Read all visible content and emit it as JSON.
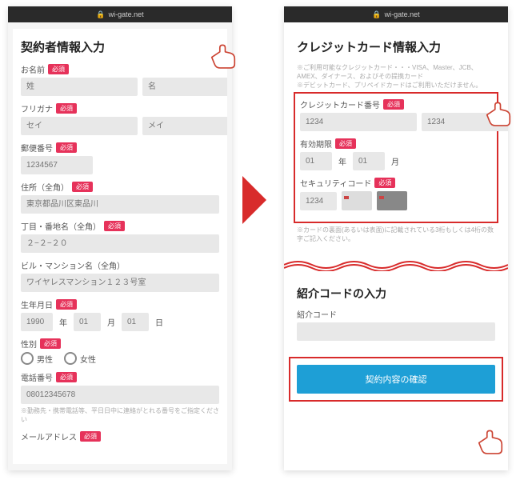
{
  "url": "wi-gate.net",
  "screen1": {
    "title": "契約者情報入力",
    "name": {
      "label": "お名前",
      "req": "必須",
      "sur": "姓",
      "giv": "名"
    },
    "kana": {
      "label": "フリガナ",
      "req": "必須",
      "sur": "セイ",
      "giv": "メイ"
    },
    "zip": {
      "label": "郵便番号",
      "req": "必須",
      "ph": "1234567"
    },
    "addr": {
      "label": "住所（全角）",
      "req": "必須",
      "ph": "東京都品川区東品川"
    },
    "addr2": {
      "label": "丁目・番地名（全角）",
      "req": "必須",
      "ph": "２−２−２０"
    },
    "bldg": {
      "label": "ビル・マンション名（全角）",
      "ph": "ワイヤレスマンション１２３号室"
    },
    "dob": {
      "label": "生年月日",
      "req": "必須",
      "y": "1990",
      "yU": "年",
      "m": "01",
      "mU": "月",
      "d": "01",
      "dU": "日"
    },
    "sex": {
      "label": "性別",
      "req": "必須",
      "m": "男性",
      "f": "女性"
    },
    "tel": {
      "label": "電話番号",
      "req": "必須",
      "ph": "08012345678",
      "note": "※勤務先・携帯電話等、平日日中に連絡がとれる番号をご指定ください"
    },
    "mail": {
      "label": "メールアドレス",
      "req": "必須"
    }
  },
  "screen2": {
    "ccTitle": "クレジットカード情報入力",
    "ccNote": "※ご利用可能なクレジットカード・・・VISA、Master、JCB、AMEX、ダイナース、およびその提携カード\n※デビットカード、プリペイドカードはご利用いただけません。",
    "ccNum": {
      "label": "クレジットカード番号",
      "req": "必須",
      "ph": "1234"
    },
    "exp": {
      "label": "有効期限",
      "req": "必須",
      "y": "01",
      "yU": "年",
      "m": "01",
      "mU": "月"
    },
    "cvv": {
      "label": "セキュリティコード",
      "req": "必須",
      "ph": "1234"
    },
    "cvvNote": "※カードの裏面(あるいは表面)に記載されている3桁もしくは4桁の数字ご記入ください。",
    "refTitle": "紹介コードの入力",
    "refLabel": "紹介コード",
    "confirm": "契約内容の確認"
  }
}
